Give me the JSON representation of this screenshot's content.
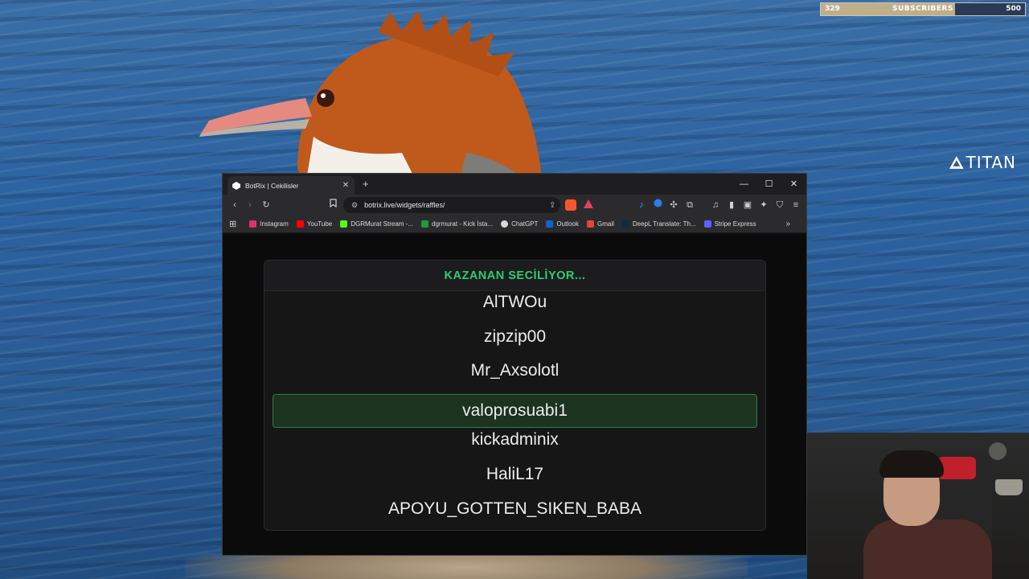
{
  "overlay": {
    "subscribers": {
      "label": "SUBSCRIBERS",
      "current": "329",
      "goal": "500",
      "progress": 0.658
    },
    "brand": "TITAN"
  },
  "browser": {
    "tab": {
      "title": "BotRix | Cekilisler",
      "favicon": "botrix-icon"
    },
    "window_controls": [
      "minimize",
      "maximize",
      "close"
    ],
    "address": {
      "url": "botrix.live/widgets/raffles/"
    },
    "bookmarks": [
      {
        "label": "Instagram",
        "icon": "instagram-icon",
        "color": "#e1306c"
      },
      {
        "label": "YouTube",
        "icon": "youtube-icon",
        "color": "#ff0000"
      },
      {
        "label": "DGRMurat Stream -...",
        "icon": "kick-icon",
        "color": "#53fc18"
      },
      {
        "label": "dgrmurat - Kick İsta...",
        "icon": "kick-stats-icon",
        "color": "#1f9d3a"
      },
      {
        "label": "ChatGPT",
        "icon": "chatgpt-icon",
        "color": "#d9d9d9"
      },
      {
        "label": "Outlook",
        "icon": "outlook-icon",
        "color": "#0a64d8"
      },
      {
        "label": "Gmail",
        "icon": "gmail-icon",
        "color": "#ea4335"
      },
      {
        "label": "DeepL Translate: Th...",
        "icon": "deepl-icon",
        "color": "#0f2b46"
      },
      {
        "label": "Stripe Express",
        "icon": "stripe-icon",
        "color": "#635bff"
      }
    ]
  },
  "raffle": {
    "header": "KAZANAN SECİLİYOR...",
    "header_color": "#2ecc71",
    "names": [
      "AlTWOu",
      "zipzip00",
      "Mr_Axsolotl",
      "valoprosuabi1",
      "kickadminix",
      "HaliL17",
      "APOYU_GOTTEN_SIKEN_BABA"
    ],
    "selected_index": 3
  }
}
